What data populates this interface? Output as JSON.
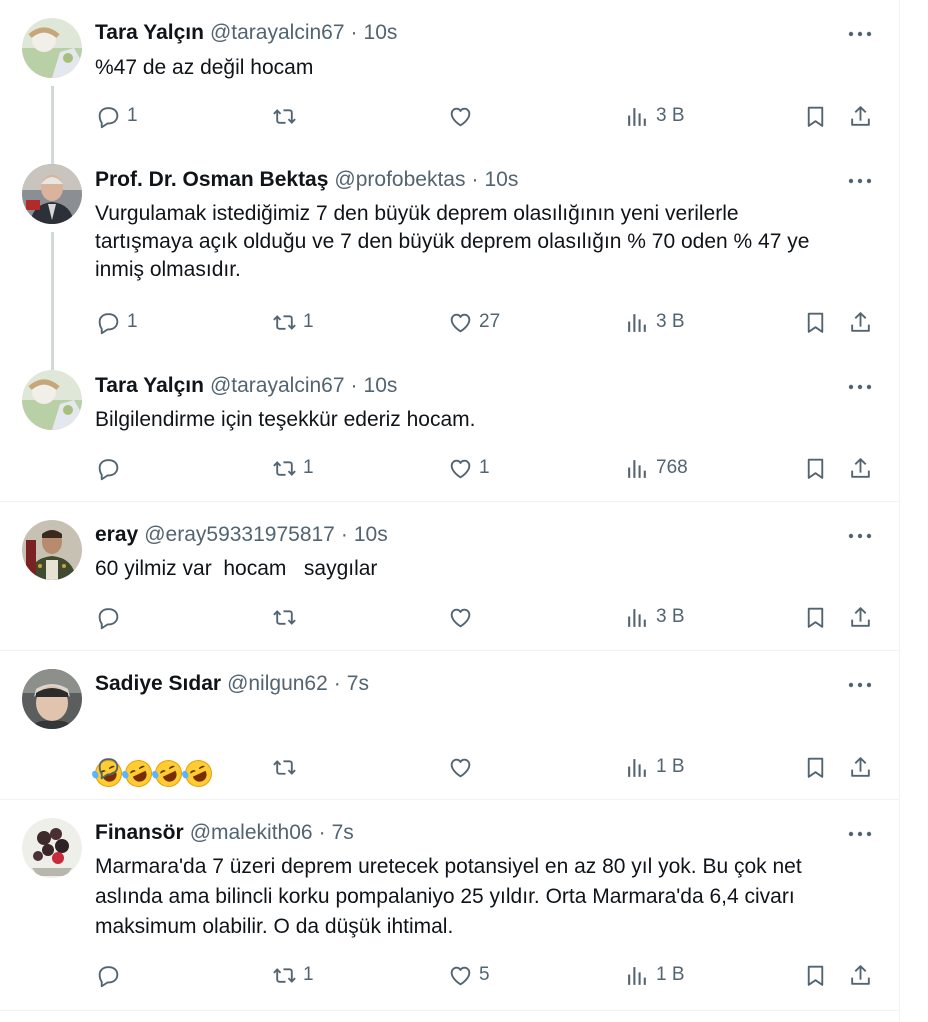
{
  "tweets": [
    {
      "name": "Tara Yalçın",
      "handle": "@tarayalcin67",
      "time": "10s",
      "text": "%47 de az değil hocam",
      "replies": "1",
      "retweets": "",
      "likes": "",
      "views": "3 B"
    },
    {
      "name": "Prof. Dr. Osman Bektaş",
      "handle": "@profobektas",
      "time": "10s",
      "text": "Vurgulamak istediğimiz 7 den büyük deprem olasılığının yeni verilerle\ntartışmaya açık olduğu ve 7 den büyük deprem olasılığın % 70 oden % 47 ye\ninmiş olmasıdır.",
      "replies": "1",
      "retweets": "1",
      "likes": "27",
      "views": "3 B"
    },
    {
      "name": "Tara Yalçın",
      "handle": "@tarayalcin67",
      "time": "10s",
      "text": "Bilgilendirme için teşekkür ederiz hocam.",
      "replies": "",
      "retweets": "1",
      "likes": "1",
      "views": "768"
    },
    {
      "name": "eray",
      "handle": "@eray59331975817",
      "time": "10s",
      "text": "60 yilmiz var  hocam   saygılar",
      "replies": "",
      "retweets": "",
      "likes": "",
      "views": "3 B"
    },
    {
      "name": "Sadiye Sıdar",
      "handle": "@nilgun62",
      "time": "7s",
      "text": "",
      "emoji": "🤣🤣🤣🤣",
      "replies": "",
      "retweets": "",
      "likes": "",
      "views": "1 B"
    },
    {
      "name": "Finansör",
      "handle": "@malekith06",
      "time": "7s",
      "text": "Marmara'da 7 üzeri deprem uretecek potansiyel en az 80 yıl yok. Bu çok net\naslında ama bilincli korku pompalaniyo 25 yıldır. Orta Marmara'da 6,4 civarı\nmaksimum olabilir. O da düşük ihtimal.",
      "replies": "",
      "retweets": "1",
      "likes": "5",
      "views": "1 B"
    }
  ],
  "separator": "·",
  "icons": {
    "reply": "reply-icon",
    "retweet": "retweet-icon",
    "like": "heart-icon",
    "views": "views-chart-icon",
    "bookmark": "bookmark-icon",
    "share": "share-icon",
    "more": "more-dots-icon"
  },
  "colors": {
    "text": "#0f1419",
    "secondary": "#536471",
    "divider": "#eff3f4",
    "thread_line": "#cfd9de"
  }
}
